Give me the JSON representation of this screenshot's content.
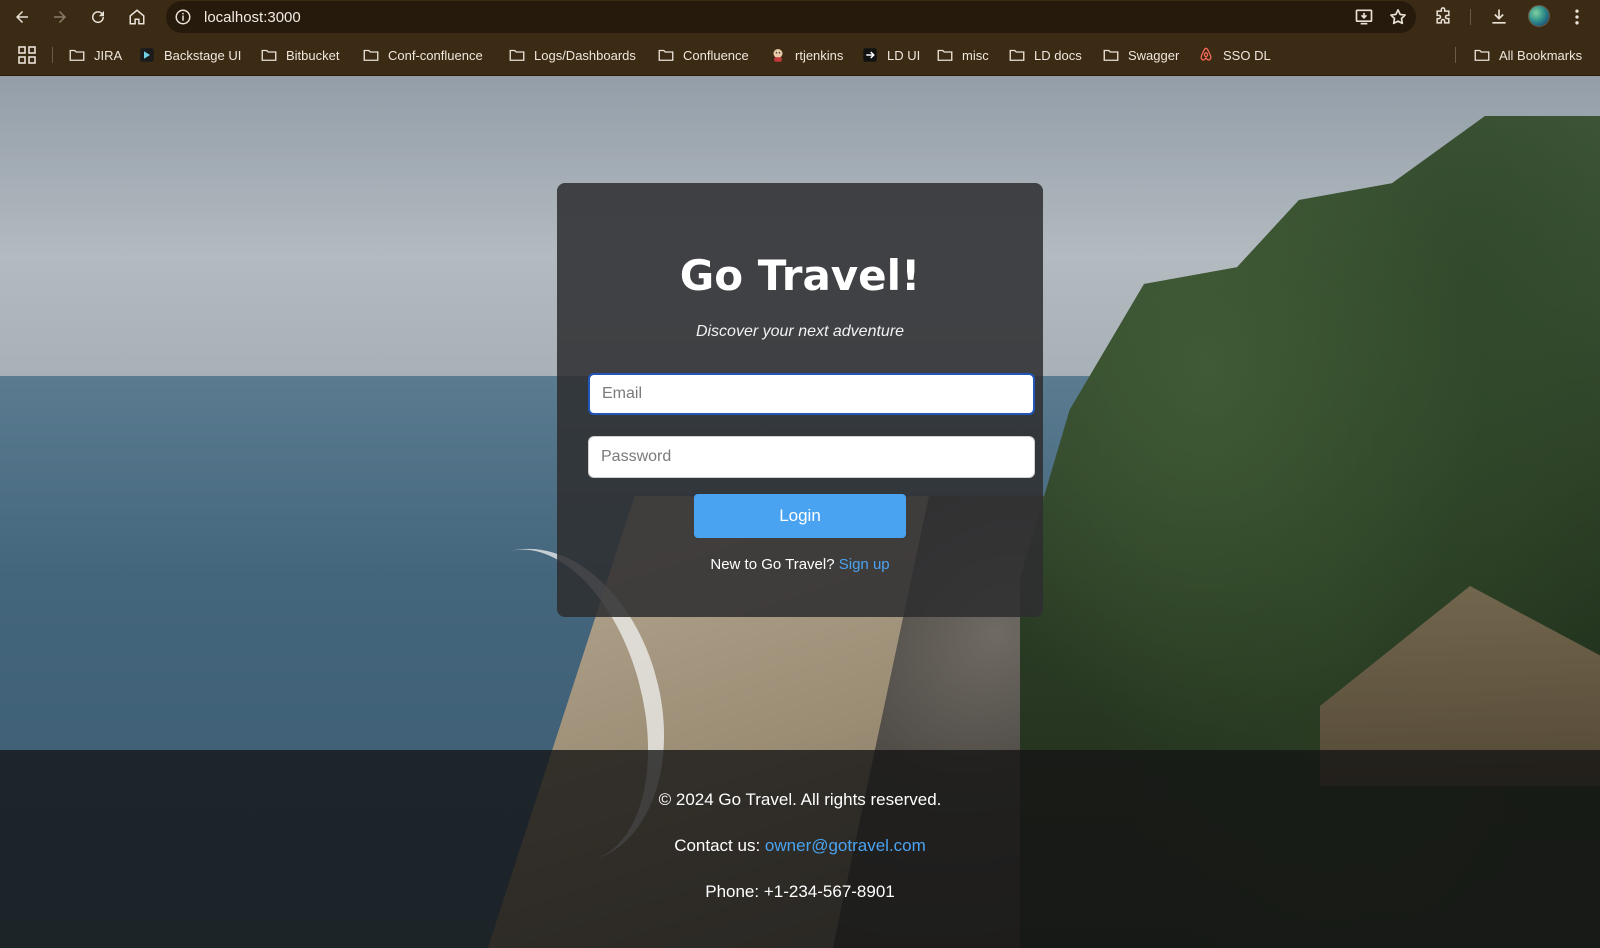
{
  "browser": {
    "url": "localhost:3000",
    "bookmarks": [
      {
        "label": "JIRA",
        "icon": "folder-icon"
      },
      {
        "label": "Backstage UI",
        "icon": "backstage-icon"
      },
      {
        "label": "Bitbucket",
        "icon": "folder-icon"
      },
      {
        "label": "Conf-confluence",
        "icon": "folder-icon"
      },
      {
        "label": "Logs/Dashboards",
        "icon": "folder-icon"
      },
      {
        "label": "Confluence",
        "icon": "folder-icon"
      },
      {
        "label": "rtjenkins",
        "icon": "jenkins-icon"
      },
      {
        "label": "LD UI",
        "icon": "launchdarkly-icon"
      },
      {
        "label": "misc",
        "icon": "folder-icon"
      },
      {
        "label": "LD docs",
        "icon": "folder-icon"
      },
      {
        "label": "Swagger",
        "icon": "folder-icon"
      },
      {
        "label": "SSO DL",
        "icon": "airbnb-icon"
      }
    ],
    "all_bookmarks_label": "All Bookmarks"
  },
  "login": {
    "title": "Go Travel!",
    "subtitle": "Discover your next adventure",
    "email_placeholder": "Email",
    "email_value": "",
    "password_placeholder": "Password",
    "password_value": "",
    "login_label": "Login",
    "signup_prompt": "New to Go Travel?",
    "signup_link": "Sign up"
  },
  "footer": {
    "copyright": "© 2024 Go Travel. All rights reserved.",
    "contact_label": "Contact us:",
    "contact_email": "owner@gotravel.com",
    "phone": "Phone: +1-234-567-8901"
  },
  "colors": {
    "browser_chrome": "#3b2a14",
    "accent_blue": "#4aa3f0",
    "card_bg": "#2d2d30",
    "focus_ring": "#1f56b8"
  }
}
